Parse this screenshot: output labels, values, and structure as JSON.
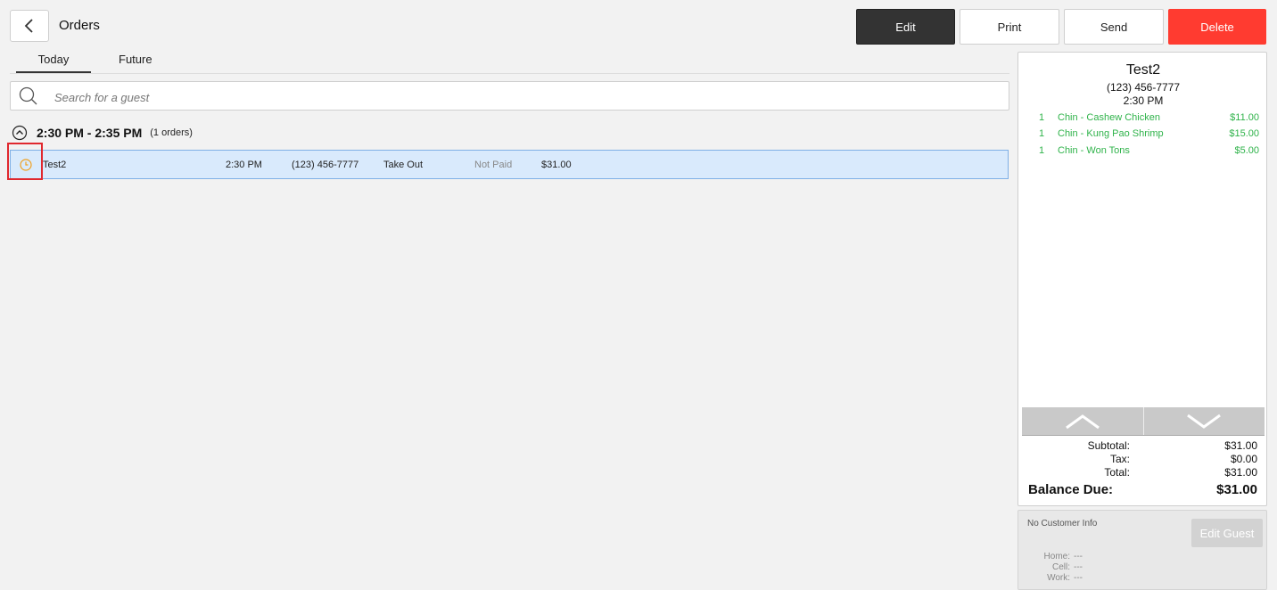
{
  "header": {
    "title": "Orders"
  },
  "toolbar": {
    "edit": "Edit",
    "print": "Print",
    "send": "Send",
    "delete": "Delete"
  },
  "tabs": [
    "Today",
    "Future"
  ],
  "search": {
    "placeholder": "Search for a guest"
  },
  "groups": [
    {
      "range": "2:30 PM - 2:35 PM",
      "count": "(1 orders)",
      "orders": [
        {
          "name": "Test2",
          "time": "2:30 PM",
          "phone": "(123) 456-7777",
          "type": "Take Out",
          "status": "Not Paid",
          "amount": "$31.00"
        }
      ]
    }
  ],
  "order_detail": {
    "name": "Test2",
    "phone": "(123) 456-7777",
    "time": "2:30 PM",
    "items": [
      {
        "qty": "1",
        "name": "Chin - Cashew Chicken",
        "price": "$11.00"
      },
      {
        "qty": "1",
        "name": "Chin - Kung Pao Shrimp",
        "price": "$15.00"
      },
      {
        "qty": "1",
        "name": "Chin - Won Tons",
        "price": "$5.00"
      }
    ],
    "subtotal_label": "Subtotal:",
    "subtotal": "$31.00",
    "tax_label": "Tax:",
    "tax": "$0.00",
    "total_label": "Total:",
    "total": "$31.00",
    "balance_label": "Balance Due:",
    "balance": "$31.00"
  },
  "customer": {
    "none_text": "No Customer Info",
    "edit_guest": "Edit Guest",
    "fields": [
      {
        "label": "Home:",
        "value": "---"
      },
      {
        "label": "Cell:",
        "value": "---"
      },
      {
        "label": "Work:",
        "value": "---"
      }
    ]
  },
  "colors": {
    "accent_dark": "#333333",
    "delete": "#ff3b30",
    "item_green": "#2fb34a",
    "row_selected": "#d9eafc",
    "clock_icon": "#f0a020"
  }
}
